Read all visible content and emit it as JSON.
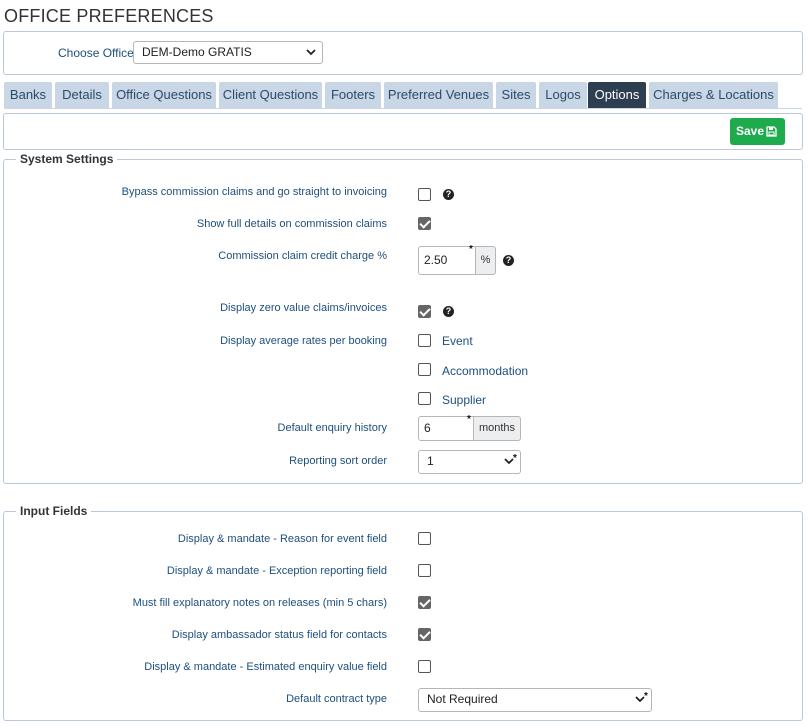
{
  "page": {
    "title": "OFFICE PREFERENCES"
  },
  "office": {
    "label": "Choose Office:",
    "selected": "DEM-Demo GRATIS"
  },
  "tabs": [
    {
      "label": "Banks"
    },
    {
      "label": "Details"
    },
    {
      "label": "Office Questions"
    },
    {
      "label": "Client Questions"
    },
    {
      "label": "Footers"
    },
    {
      "label": "Preferred Venues"
    },
    {
      "label": "Sites"
    },
    {
      "label": "Logos"
    },
    {
      "label": "Options",
      "active": true
    },
    {
      "label": "Charges & Locations"
    }
  ],
  "toolbar": {
    "save_label": "Save"
  },
  "system": {
    "legend": "System Settings",
    "bypass": {
      "label": "Bypass commission claims and go straight to invoicing",
      "checked": false
    },
    "show_full": {
      "label": "Show full details on commission claims",
      "checked": true
    },
    "credit_charge": {
      "label": "Commission claim credit charge %",
      "value": "2.50",
      "unit": "%"
    },
    "zero_value": {
      "label": "Display zero value claims/invoices",
      "checked": true
    },
    "avg_rates": {
      "label": "Display average rates per booking",
      "options": [
        {
          "label": "Event",
          "checked": false
        },
        {
          "label": "Accommodation",
          "checked": false
        },
        {
          "label": "Supplier",
          "checked": false
        }
      ]
    },
    "enquiry_history": {
      "label": "Default enquiry history",
      "value": "6",
      "unit": "months"
    },
    "sort_order": {
      "label": "Reporting sort order",
      "value": "1"
    }
  },
  "inputs": {
    "legend": "Input Fields",
    "rows": [
      {
        "label": "Display & mandate - Reason for event field",
        "checked": false
      },
      {
        "label": "Display & mandate - Exception reporting field",
        "checked": false
      },
      {
        "label": "Must fill explanatory notes on releases (min 5 chars)",
        "checked": true
      },
      {
        "label": "Display ambassador status field for contacts",
        "checked": true
      },
      {
        "label": "Display & mandate - Estimated enquiry value field",
        "checked": false
      }
    ],
    "contract_type": {
      "label": "Default contract type",
      "value": "Not Required"
    }
  },
  "colors": {
    "accent": "#2c3e50",
    "tab": "#c8d6e5",
    "save": "#1eab4d",
    "label": "#1d4f7c"
  }
}
